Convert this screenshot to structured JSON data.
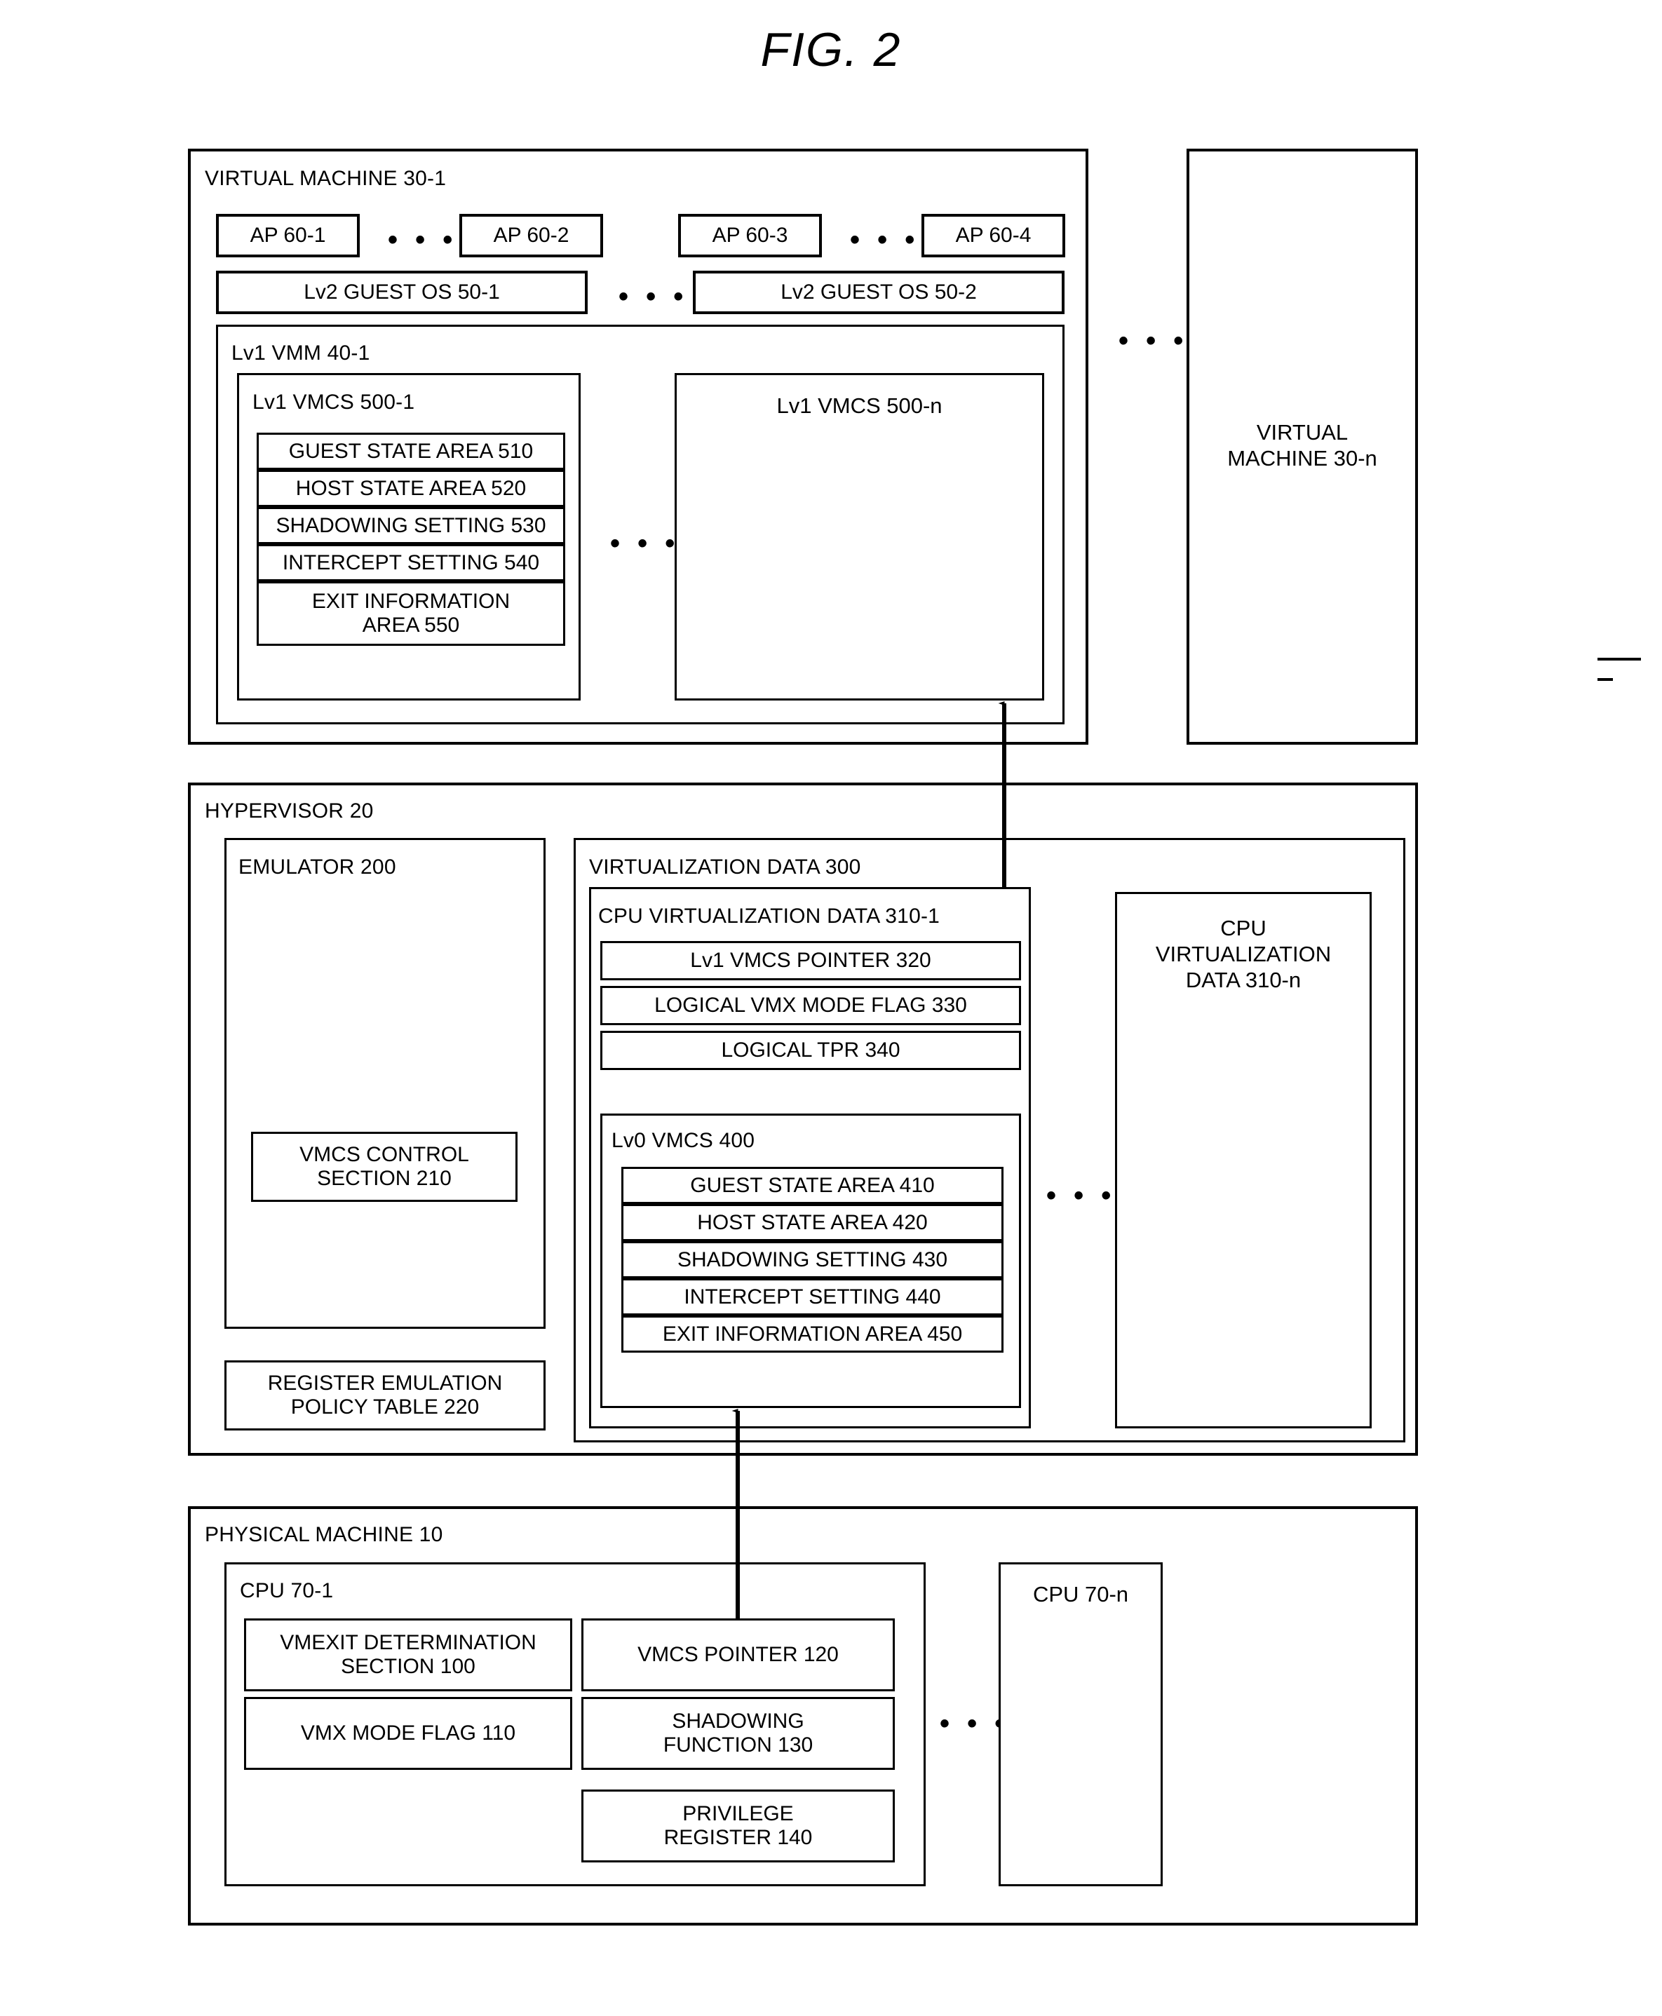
{
  "figure": {
    "title": "FIG.  2"
  },
  "virtual_machine_1": {
    "label": "VIRTUAL MACHINE 30-1",
    "apps": [
      {
        "label": "AP 60-1"
      },
      {
        "label": "AP 60-2"
      },
      {
        "label": "AP 60-3"
      },
      {
        "label": "AP 60-4"
      }
    ],
    "app_ellipsis_1": "• • •",
    "app_ellipsis_2": "• • •",
    "guest_os": [
      {
        "label": "Lv2 GUEST OS 50-1"
      },
      {
        "label": "Lv2 GUEST OS 50-2"
      }
    ],
    "guest_os_ellipsis": "• • •",
    "vmm": {
      "label": "Lv1 VMM 40-1",
      "vmcs_1": {
        "label": "Lv1 VMCS 500-1",
        "areas": [
          {
            "label": "GUEST STATE AREA 510"
          },
          {
            "label": "HOST STATE AREA 520"
          },
          {
            "label": "SHADOWING SETTING 530"
          },
          {
            "label": "INTERCEPT SETTING 540"
          },
          {
            "label": "EXIT INFORMATION\nAREA 550"
          }
        ]
      },
      "vmcs_ellipsis": "• • •",
      "vmcs_n": {
        "label": "Lv1 VMCS 500-n"
      }
    }
  },
  "vm_ellipsis": "• • •",
  "virtual_machine_n": {
    "label": "VIRTUAL\nMACHINE 30-n"
  },
  "hypervisor": {
    "label": "HYPERVISOR 20",
    "emulator": {
      "label": "EMULATOR 200",
      "vmcs_control_section": {
        "label": "VMCS CONTROL\nSECTION 210"
      }
    },
    "register_emulation_policy_table": {
      "label": "REGISTER EMULATION\nPOLICY TABLE 220"
    },
    "virtualization_data": {
      "label": "VIRTUALIZATION DATA 300",
      "cpu_virtualization_data_1": {
        "label": "CPU VIRTUALIZATION DATA 310-1",
        "fields": [
          {
            "label": "Lv1 VMCS POINTER 320"
          },
          {
            "label": "LOGICAL VMX MODE FLAG 330"
          },
          {
            "label": "LOGICAL TPR 340"
          }
        ],
        "lv0_vmcs": {
          "label": "Lv0 VMCS 400",
          "areas": [
            {
              "label": "GUEST STATE AREA 410"
            },
            {
              "label": "HOST STATE AREA 420"
            },
            {
              "label": "SHADOWING SETTING 430"
            },
            {
              "label": "INTERCEPT SETTING 440"
            },
            {
              "label": "EXIT INFORMATION AREA 450"
            }
          ]
        }
      },
      "cpu_data_ellipsis": "• • •",
      "cpu_virtualization_data_n": {
        "label": "CPU\nVIRTUALIZATION\nDATA 310-n"
      }
    }
  },
  "physical_machine": {
    "label": "PHYSICAL MACHINE 10",
    "cpu_1": {
      "label": "CPU 70-1",
      "blocks": [
        {
          "label": "VMEXIT DETERMINATION\nSECTION 100"
        },
        {
          "label": "VMCS POINTER 120"
        },
        {
          "label": "VMX MODE FLAG 110"
        },
        {
          "label": "SHADOWING\nFUNCTION 130"
        },
        {
          "label": "PRIVILEGE\nREGISTER 140"
        }
      ]
    },
    "cpu_ellipsis": "• • •",
    "cpu_n": {
      "label": "CPU 70-n"
    }
  }
}
